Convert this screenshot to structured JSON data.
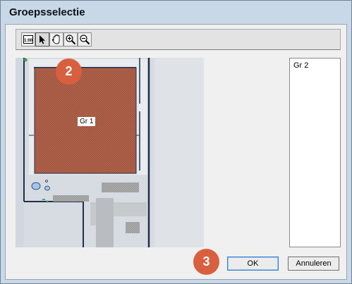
{
  "window": {
    "title": "Groepsselectie"
  },
  "toolbar": {
    "tools": [
      {
        "name": "zoom-100-tool",
        "icon": "zoom-100-icon",
        "label": "1:00"
      },
      {
        "name": "select-tool",
        "icon": "arrow-pointer-icon"
      },
      {
        "name": "pan-tool",
        "icon": "hand-icon"
      },
      {
        "name": "zoom-in-tool",
        "icon": "zoom-in-icon"
      },
      {
        "name": "zoom-out-tool",
        "icon": "zoom-out-icon"
      }
    ]
  },
  "floorplan": {
    "selected_group_label": "Gr 1",
    "selected_group_color": "#b4644c"
  },
  "groups_list": {
    "items": [
      "Gr 2"
    ]
  },
  "buttons": {
    "ok": "OK",
    "cancel": "Annuleren"
  },
  "annotations": [
    {
      "label": "2",
      "color": "#d9603e"
    },
    {
      "label": "3",
      "color": "#d9603e"
    }
  ]
}
